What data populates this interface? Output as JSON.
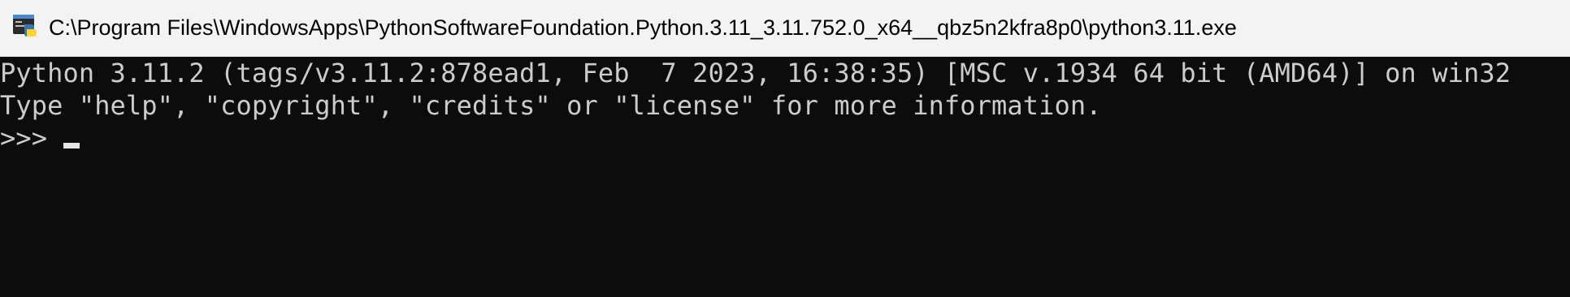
{
  "window": {
    "title": "C:\\Program Files\\WindowsApps\\PythonSoftwareFoundation.Python.3.11_3.11.752.0_x64__qbz5n2kfra8p0\\python3.11.exe",
    "icon": "python-console-icon"
  },
  "console": {
    "lines": [
      "Python 3.11.2 (tags/v3.11.2:878ead1, Feb  7 2023, 16:38:35) [MSC v.1934 64 bit (AMD64)] on win32",
      "Type \"help\", \"copyright\", \"credits\" or \"license\" for more information."
    ],
    "prompt": ">>>"
  },
  "colors": {
    "background": "#0c0c0c",
    "text": "#cccccc",
    "titlebar": "#f3f3f3"
  }
}
